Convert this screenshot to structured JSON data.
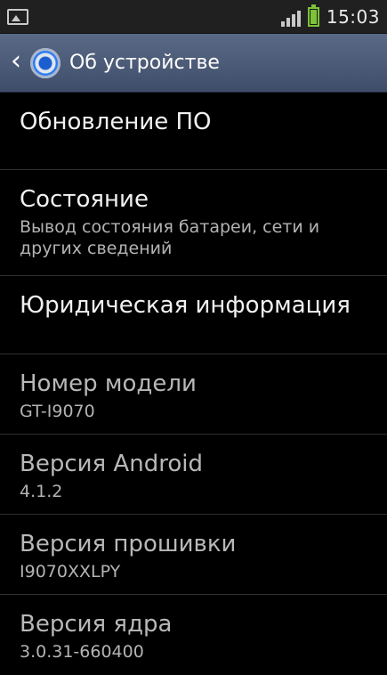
{
  "status_bar": {
    "time": "15:03",
    "icons": [
      "gallery-notification-icon",
      "signal-icon",
      "battery-icon"
    ],
    "colors": {
      "battery": "#7ec23a",
      "icons": "#c9c9c9"
    }
  },
  "action_bar": {
    "title": "Об устройстве",
    "icons": [
      "back-icon",
      "settings-icon"
    ],
    "colors": {
      "background": "#4b5a77"
    }
  },
  "items": [
    {
      "title": "Обновление ПО"
    },
    {
      "title": "Состояние",
      "subtitle": "Вывод состояния батареи, сети и других сведений"
    },
    {
      "title": "Юридическая информация"
    },
    {
      "title": "Номер модели",
      "subtitle": "GT-I9070"
    },
    {
      "title": "Версия Android",
      "subtitle": "4.1.2"
    },
    {
      "title": "Версия прошивки",
      "subtitle": "I9070XXLPY"
    },
    {
      "title": "Версия ядра",
      "subtitle": "3.0.31-660400"
    }
  ]
}
